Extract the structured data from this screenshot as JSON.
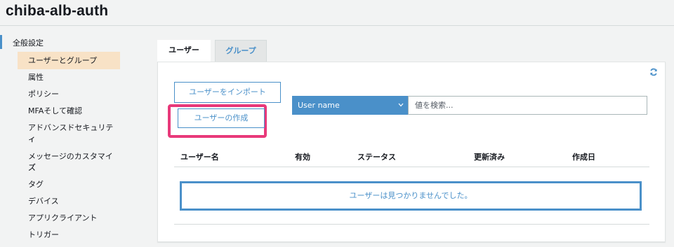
{
  "app": {
    "title": "chiba-alb-auth"
  },
  "sidebar": {
    "section_label": "全般設定",
    "items": [
      {
        "label": "ユーザーとグループ",
        "active": true
      },
      {
        "label": "属性"
      },
      {
        "label": "ポリシー"
      },
      {
        "label": "MFAそして確認"
      },
      {
        "label": "アドバンスドセキュリティ"
      },
      {
        "label": "ィ"
      },
      {
        "label": "メッセージのカスタマイズ"
      },
      {
        "label": "ズ"
      },
      {
        "label": "タグ"
      },
      {
        "label": "デバイス"
      },
      {
        "label": "アプリクライアント"
      },
      {
        "label": "トリガー"
      }
    ]
  },
  "tabs": [
    {
      "label": "ユーザー",
      "active": true
    },
    {
      "label": "グループ",
      "active": false
    }
  ],
  "toolbar": {
    "import_label": "ユーザーをインポート",
    "create_label": "ユーザーの作成",
    "filter_selected": "User name",
    "search_placeholder": "値を検索...",
    "refresh_icon": "refresh-icon"
  },
  "table": {
    "columns": [
      "ユーザー名",
      "有効",
      "ステータス",
      "更新済み",
      "作成日"
    ],
    "empty_message": "ユーザーは見つかりませんでした。"
  },
  "colors": {
    "accent": "#4a90c9",
    "highlight": "#e8397a",
    "active_nav_bg": "#f8e2c6"
  }
}
